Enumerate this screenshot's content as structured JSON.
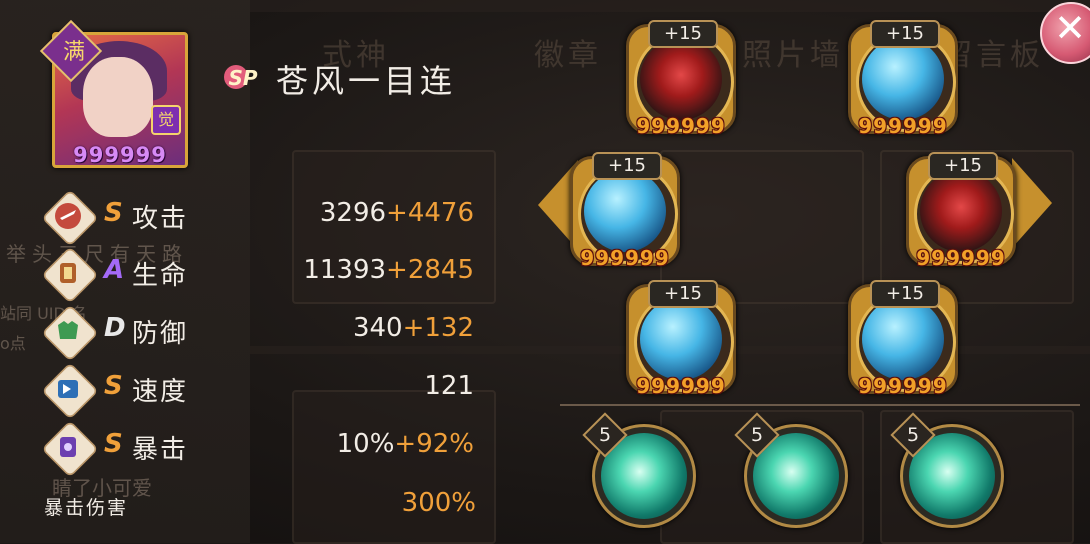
{
  "background": {
    "tabs": [
      "式神",
      "徽章",
      "照片墙",
      "留言板"
    ],
    "ghost_texts": [
      "举头三尺有天路",
      "站同 UID 名",
      "o点",
      "睛了小可爱"
    ]
  },
  "character": {
    "portrait_badge": "满",
    "awaken_badge": "觉",
    "level_number": "999999",
    "rarity": "SP",
    "name": "苍风一目连"
  },
  "stats": [
    {
      "icon": "attack-icon",
      "grade": "S",
      "label": "攻击",
      "base": "3296",
      "bonus": "+4476"
    },
    {
      "icon": "hp-icon",
      "grade": "A",
      "label": "生命",
      "base": "11393",
      "bonus": "+2845"
    },
    {
      "icon": "defense-icon",
      "grade": "D",
      "label": "防御",
      "base": "340",
      "bonus": "+132"
    },
    {
      "icon": "speed-icon",
      "grade": "S",
      "label": "速度",
      "base": "121",
      "bonus": ""
    },
    {
      "icon": "crit-icon",
      "grade": "S",
      "label": "暴击",
      "base": "10%",
      "bonus": "+92%"
    }
  ],
  "crit_damage": {
    "label": "暴击伤害",
    "value": "300%"
  },
  "grade_colors": {
    "S": "#f0a03a",
    "A": "#a46af7",
    "D": "#e8e8e8"
  },
  "souls": [
    {
      "slot": 1,
      "plus": "+15",
      "number": "999999",
      "art": "red"
    },
    {
      "slot": 2,
      "plus": "+15",
      "number": "999999",
      "art": "blue"
    },
    {
      "slot": 3,
      "plus": "+15",
      "number": "999999",
      "art": "blue"
    },
    {
      "slot": 4,
      "plus": "+15",
      "number": "999999",
      "art": "red"
    },
    {
      "slot": 5,
      "plus": "+15",
      "number": "999999",
      "art": "blue"
    },
    {
      "slot": 6,
      "plus": "+15",
      "number": "999999",
      "art": "blue"
    }
  ],
  "skills": [
    {
      "level": "5",
      "icon": "wind-dragon-icon"
    },
    {
      "level": "5",
      "icon": "wind-figure-icon"
    },
    {
      "level": "5",
      "icon": "wind-dragon-icon"
    }
  ],
  "close_label": "✕"
}
